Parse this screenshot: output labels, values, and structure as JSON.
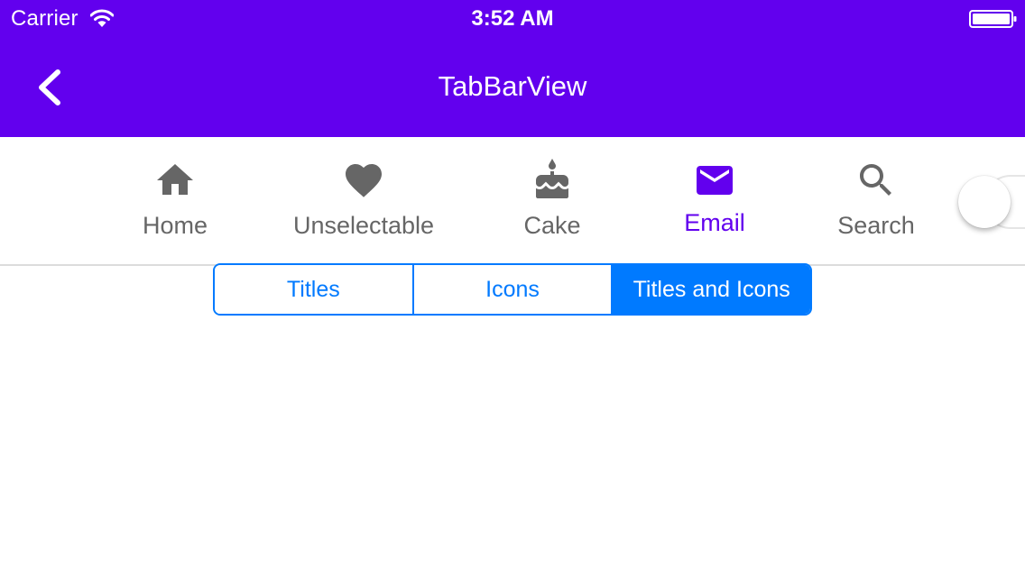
{
  "status_bar": {
    "carrier": "Carrier",
    "time": "3:52 AM"
  },
  "nav_bar": {
    "title": "TabBarView",
    "background": "#6200EE"
  },
  "tabs": [
    {
      "label": "Home",
      "icon": "home-icon",
      "selected": false
    },
    {
      "label": "Unselectable",
      "icon": "heart-icon",
      "selected": false
    },
    {
      "label": "Cake",
      "icon": "cake-icon",
      "selected": false
    },
    {
      "label": "Email",
      "icon": "email-icon",
      "selected": true
    },
    {
      "label": "Search",
      "icon": "search-icon",
      "selected": false
    }
  ],
  "toggle": {
    "on": false
  },
  "segmented_control": {
    "segments": [
      "Titles",
      "Icons",
      "Titles and Icons"
    ],
    "selected_index": 2
  },
  "colors": {
    "accent": "#6200EE",
    "tab_inactive": "#666666",
    "segment_tint": "#007AFF"
  }
}
